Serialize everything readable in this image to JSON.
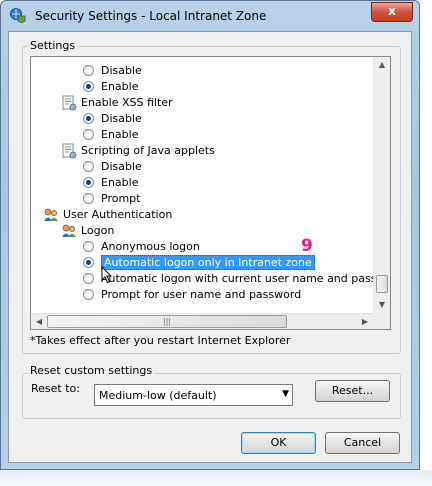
{
  "window": {
    "title": "Security Settings - Local Intranet Zone",
    "close_glyph": "x"
  },
  "settings_group": {
    "legend": "Settings",
    "items": [
      {
        "type": "option",
        "label": "Disable",
        "checked": false
      },
      {
        "type": "option",
        "label": "Enable",
        "checked": true
      },
      {
        "type": "category",
        "label": "Enable XSS filter",
        "icon": "script-settings-icon"
      },
      {
        "type": "option",
        "label": "Disable",
        "checked": true
      },
      {
        "type": "option",
        "label": "Enable",
        "checked": false
      },
      {
        "type": "category",
        "label": "Scripting of Java applets",
        "icon": "script-settings-icon"
      },
      {
        "type": "option",
        "label": "Disable",
        "checked": false
      },
      {
        "type": "option",
        "label": "Enable",
        "checked": true
      },
      {
        "type": "option",
        "label": "Prompt",
        "checked": false
      },
      {
        "type": "category",
        "label": "User Authentication",
        "icon": "users-icon"
      },
      {
        "type": "category",
        "label": "Logon",
        "icon": "users-icon"
      },
      {
        "type": "option",
        "label": "Anonymous logon",
        "checked": false
      },
      {
        "type": "option",
        "label": "Automatic logon only in Intranet zone",
        "checked": true,
        "selected": true
      },
      {
        "type": "option",
        "label": "Automatic logon with current user name and password",
        "checked": false
      },
      {
        "type": "option",
        "label": "Prompt for user name and password",
        "checked": false
      }
    ],
    "note": "*Takes effect after you restart Internet Explorer"
  },
  "annotation": {
    "marker": "9",
    "color": "#e02080"
  },
  "reset_group": {
    "legend": "Reset custom settings",
    "reset_to_label": "Reset to:",
    "selected_option": "Medium-low (default)",
    "reset_button": "Reset..."
  },
  "footer": {
    "ok_button": "OK",
    "cancel_button": "Cancel"
  },
  "colors": {
    "selection": "#3399ff",
    "title_gradient": "#b9d1ea",
    "close": "#c23c1e"
  }
}
